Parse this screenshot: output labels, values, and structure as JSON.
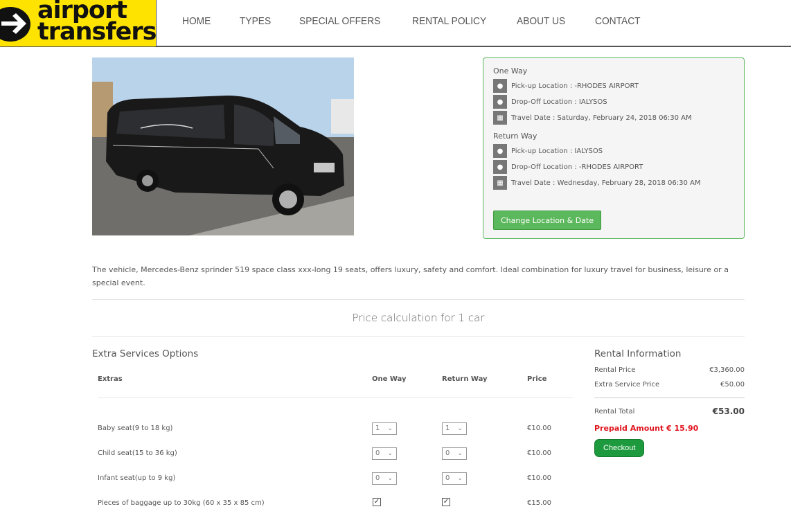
{
  "header": {
    "logo_line1": "airport",
    "logo_line2": "transfers",
    "nav": [
      "HOME",
      "TYPES",
      "SPECIAL OFFERS",
      "RENTAL POLICY",
      "ABOUT US",
      "CONTACT"
    ]
  },
  "vehicle": {
    "image_alt": "Black Mercedes-Benz Sprinter minibus (Limo VIP)",
    "description": "The vehicle, Mercedes-Benz sprinder 519 space class xxx-long 19 seats, offers luxury, safety and comfort. Ideal combination for luxury travel for business, leisure or a special event."
  },
  "trip": {
    "one_way": {
      "heading": "One Way",
      "pickup": "Pick-up Location : -RHODES AIRPORT",
      "dropoff": "Drop-Off Location : IALYSOS",
      "date": "Travel Date : Saturday, February 24, 2018  06:30 AM"
    },
    "return_way": {
      "heading": "Return Way",
      "pickup": "Pick-up Location : IALYSOS",
      "dropoff": "Drop-Off Location : -RHODES AIRPORT",
      "date": "Travel Date : Wednesday, February 28, 2018  06:30 AM"
    },
    "change_button": "Change Location & Date",
    "icons": {
      "location": "map-marker-icon",
      "date": "calendar-icon"
    }
  },
  "price_calc_title": "Price calculation for 1 car",
  "extras": {
    "title": "Extra Services Options",
    "columns": [
      "Extras",
      "One Way",
      "Return Way",
      "Price"
    ],
    "rows": [
      {
        "label": "Baby seat(9 to 18 kg)",
        "one_way": "1",
        "return_way": "1",
        "price": "€10.00",
        "type": "select"
      },
      {
        "label": "Child seat(15 to 36 kg)",
        "one_way": "0",
        "return_way": "0",
        "price": "€10.00",
        "type": "select"
      },
      {
        "label": "Infant seat(up to 9 kg)",
        "one_way": "0",
        "return_way": "0",
        "price": "€10.00",
        "type": "select"
      },
      {
        "label": "Pieces of baggage up to 30kg (60 x 35 x 85 cm)",
        "one_way": true,
        "return_way": true,
        "price": "€15.00",
        "type": "checkbox"
      }
    ]
  },
  "rental": {
    "title": "Rental Information",
    "rental_price_label": "Rental Price",
    "rental_price": "€3,360.00",
    "extra_label": "Extra Service Price",
    "extra_price": "€50.00",
    "total_label": "Rental Total",
    "total": "€53.00",
    "prepaid": "Prepaid Amount € 15.90",
    "checkout": "Checkout"
  },
  "colors": {
    "logo_bg": "#ffe300",
    "accent_green": "#5cb85c",
    "checkout_green": "#1d9a3d",
    "prepaid_red": "#e0141e"
  }
}
